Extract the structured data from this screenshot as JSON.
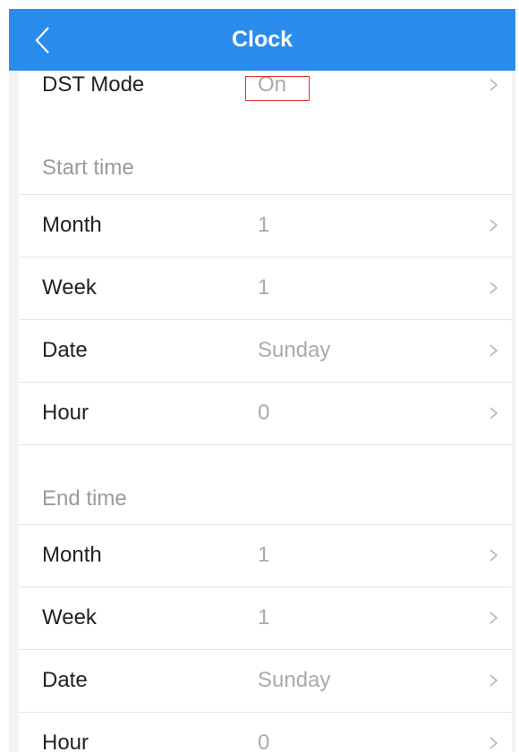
{
  "header": {
    "title": "Clock",
    "back_icon": "chevron-left-icon"
  },
  "dst": {
    "label": "DST Mode",
    "value": "On"
  },
  "start": {
    "heading": "Start time",
    "rows": [
      {
        "label": "Month",
        "value": "1"
      },
      {
        "label": "Week",
        "value": "1"
      },
      {
        "label": "Date",
        "value": "Sunday"
      },
      {
        "label": "Hour",
        "value": "0"
      }
    ]
  },
  "end": {
    "heading": "End time",
    "rows": [
      {
        "label": "Month",
        "value": "1"
      },
      {
        "label": "Week",
        "value": "1"
      },
      {
        "label": "Date",
        "value": "Sunday"
      },
      {
        "label": "Hour",
        "value": "0"
      }
    ]
  },
  "colors": {
    "header": "#2a8cec",
    "highlight": "#e03131"
  }
}
